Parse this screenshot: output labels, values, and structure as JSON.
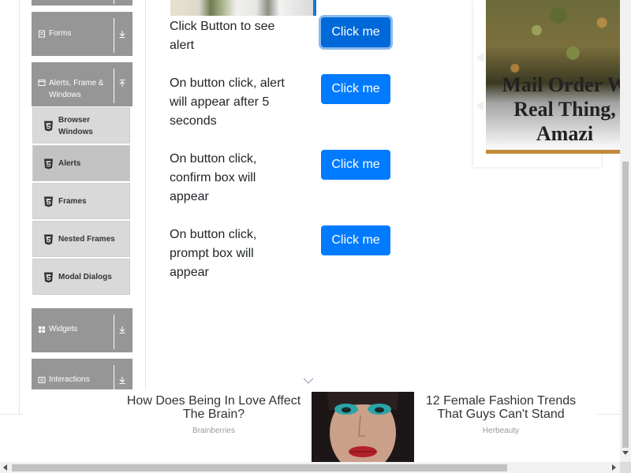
{
  "sidebar": {
    "groups": [
      {
        "label": "Forms",
        "icon": "form-icon",
        "arrow": "download-arrow-icon"
      },
      {
        "label": "Alerts, Frame & Windows",
        "icon": "window-icon",
        "arrow": "upload-arrow-icon"
      },
      {
        "label": "Widgets",
        "icon": "grid-icon",
        "arrow": "download-arrow-icon"
      },
      {
        "label": "Interactions",
        "icon": "interaction-icon",
        "arrow": "download-arrow-icon"
      }
    ],
    "sub_items": [
      {
        "label": "Browser Windows",
        "icon": "html5-icon"
      },
      {
        "label": "Alerts",
        "icon": "html5-icon",
        "active": true
      },
      {
        "label": "Frames",
        "icon": "html5-icon"
      },
      {
        "label": "Nested Frames",
        "icon": "html5-icon"
      },
      {
        "label": "Modal Dialogs",
        "icon": "html5-icon"
      }
    ]
  },
  "main": {
    "rows": [
      {
        "text": "Click Button to see alert",
        "button": "Click me"
      },
      {
        "text": "On button click, alert will appear after 5 seconds",
        "button": "Click me"
      },
      {
        "text": "On button click, confirm box will appear",
        "button": "Click me"
      },
      {
        "text": "On button click, prompt box will appear",
        "button": "Click me"
      }
    ]
  },
  "right_ad": {
    "headline_lines": [
      "Mail Order W",
      "Real Thing,",
      "Amazi"
    ]
  },
  "bottom_ad": {
    "left": {
      "title": "How Does Being In Love Affect The Brain?",
      "source": "Brainberries"
    },
    "right": {
      "title": "12 Female Fashion Trends That Guys Can't Stand",
      "source": "Herbeauty"
    }
  },
  "colors": {
    "primary_button": "#007bff",
    "sidebar_group": "#969696",
    "sidebar_sub": "#d9d9d9",
    "sidebar_sub_active": "#c2c2c2"
  }
}
